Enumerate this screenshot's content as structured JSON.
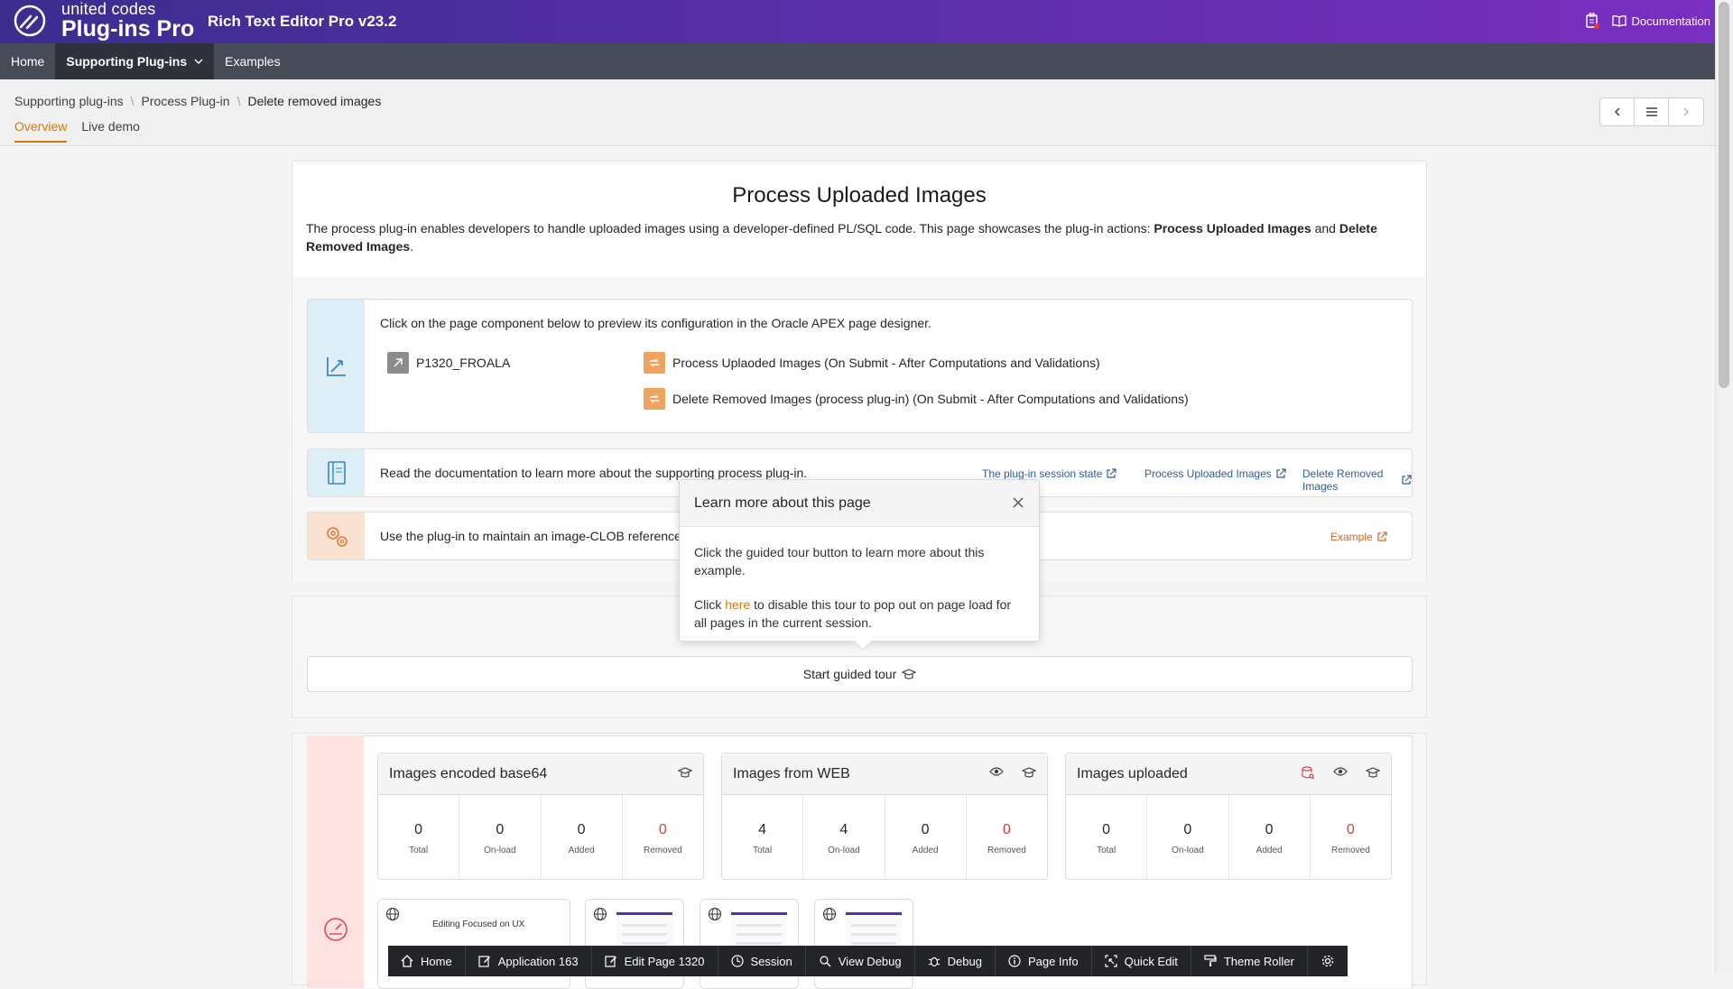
{
  "header": {
    "logo_small": "united codes",
    "logo_big": "Plug-ins Pro",
    "app_title": "Rich Text Editor Pro v23.2",
    "documentation": "Documentation",
    "brand_color": "#5a2fa8"
  },
  "nav": {
    "items": [
      {
        "label": "Home"
      },
      {
        "label": "Supporting Plug-ins"
      },
      {
        "label": "Examples"
      }
    ]
  },
  "breadcrumb": {
    "items": [
      "Supporting plug-ins",
      "Process Plug-in",
      "Delete removed images"
    ]
  },
  "tabs": [
    "Overview",
    "Live demo"
  ],
  "main": {
    "title": "Process Uploaded Images",
    "intro_text": "The process plug-in enables developers to handle uploaded images using a developer-defined PL/SQL code. This page showcases the plug-in actions: ",
    "intro_bold1": "Process Uploaded Images",
    "intro_and": " and ",
    "intro_bold2": "Delete Removed Images",
    "intro_end": ".",
    "card1": {
      "text": "Click on the page component below to preview its configuration in the Oracle APEX page designer.",
      "item": "P1320_FROALA",
      "process1": "Process Uplaoded Images (On Submit - After Computations and Validations)",
      "process2": "Delete Removed Images (process plug-in) (On Submit - After Computations and Validations)"
    },
    "card2": {
      "text": "Read the documentation to learn more about the supporting process plug-in.",
      "links": [
        "The plug-in session state",
        "Process Uploaded Images",
        "Delete Removed Images"
      ]
    },
    "card3": {
      "text": "Use the plug-in to maintain an image-CLOB reference",
      "link": "Example"
    },
    "tour_button": "Start guided tour"
  },
  "popup": {
    "title": "Learn more about this page",
    "p1": "Click the guided tour button to learn more about this example.",
    "p2_before": "Click ",
    "p2_link": "here",
    "p2_after": " to disable this tour to pop out on page load for all pages in the current session."
  },
  "stats": [
    {
      "title": "Images encoded base64",
      "cells": [
        {
          "value": "0",
          "label": "Total"
        },
        {
          "value": "0",
          "label": "On-load"
        },
        {
          "value": "0",
          "label": "Added"
        },
        {
          "value": "0",
          "label": "Removed"
        }
      ]
    },
    {
      "title": "Images from WEB",
      "cells": [
        {
          "value": "4",
          "label": "Total"
        },
        {
          "value": "4",
          "label": "On-load"
        },
        {
          "value": "0",
          "label": "Added"
        },
        {
          "value": "0",
          "label": "Removed"
        }
      ]
    },
    {
      "title": "Images uploaded",
      "cells": [
        {
          "value": "0",
          "label": "Total"
        },
        {
          "value": "0",
          "label": "On-load"
        },
        {
          "value": "0",
          "label": "Added"
        },
        {
          "value": "0",
          "label": "Removed"
        }
      ]
    }
  ],
  "thumb_caption": "Editing Focused on UX",
  "devbar": {
    "items": [
      "Home",
      "Application 163",
      "Edit Page 1320",
      "Session",
      "View Debug",
      "Debug",
      "Page Info",
      "Quick Edit",
      "Theme Roller"
    ]
  }
}
